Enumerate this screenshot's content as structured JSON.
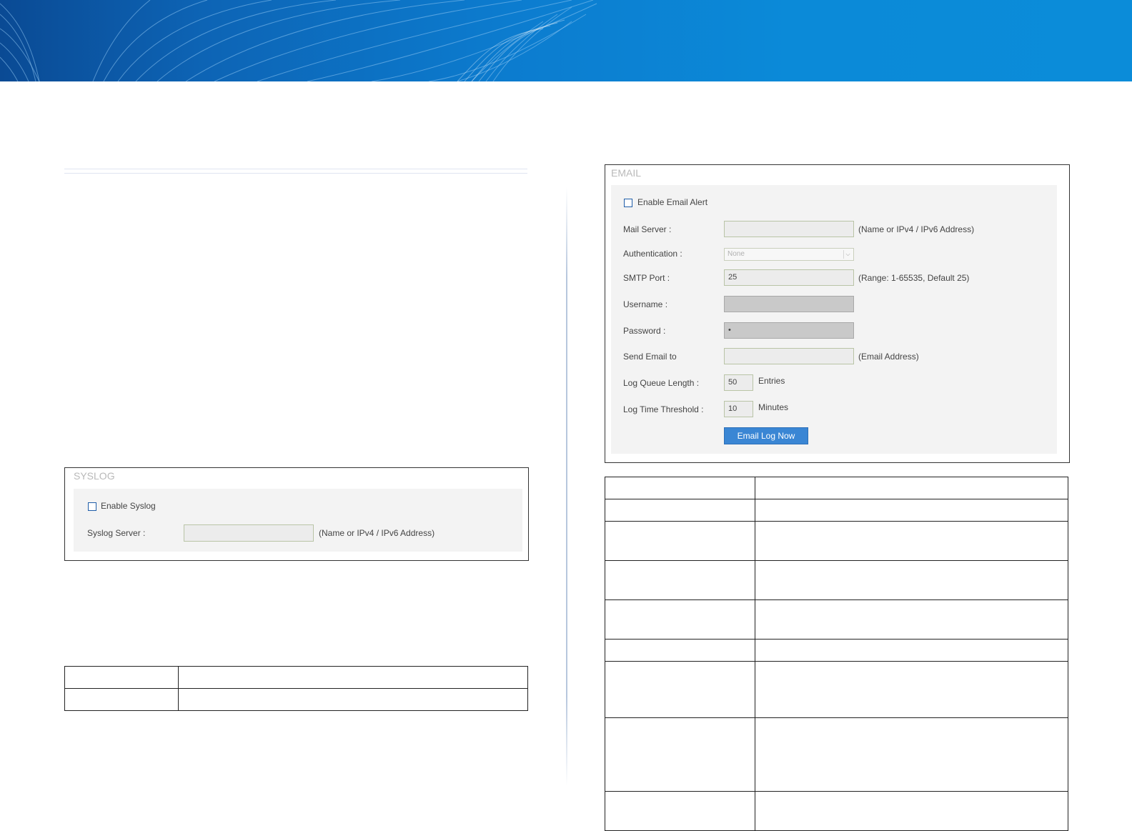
{
  "syslog": {
    "title": "SYSLOG",
    "enable_label": "Enable Syslog",
    "server_label": "Syslog Server :",
    "server_value": "",
    "server_hint": "(Name or IPv4 / IPv6 Address)"
  },
  "email": {
    "title": "EMAIL",
    "enable_label": "Enable Email Alert",
    "mail_server_label": "Mail Server :",
    "mail_server_value": "",
    "mail_server_hint": "(Name or IPv4 / IPv6 Address)",
    "auth_label": "Authentication :",
    "auth_value": "None",
    "smtp_label": "SMTP Port :",
    "smtp_value": "25",
    "smtp_hint": "(Range: 1-65535, Default 25)",
    "username_label": "Username :",
    "username_value": "",
    "password_label": "Password :",
    "password_value": "•",
    "send_to_label": "Send Email to",
    "send_to_value": "",
    "send_to_hint": "(Email Address)",
    "queue_label": "Log Queue Length :",
    "queue_value": "50",
    "queue_unit": "Entries",
    "threshold_label": "Log Time Threshold :",
    "threshold_value": "10",
    "threshold_unit": "Minutes",
    "email_now_button": "Email Log Now"
  },
  "colors": {
    "banner_dark": "#0a4a94",
    "banner_light": "#0b8cd9",
    "button_blue": "#3a86d4",
    "checkbox_blue": "#1f5da8"
  }
}
